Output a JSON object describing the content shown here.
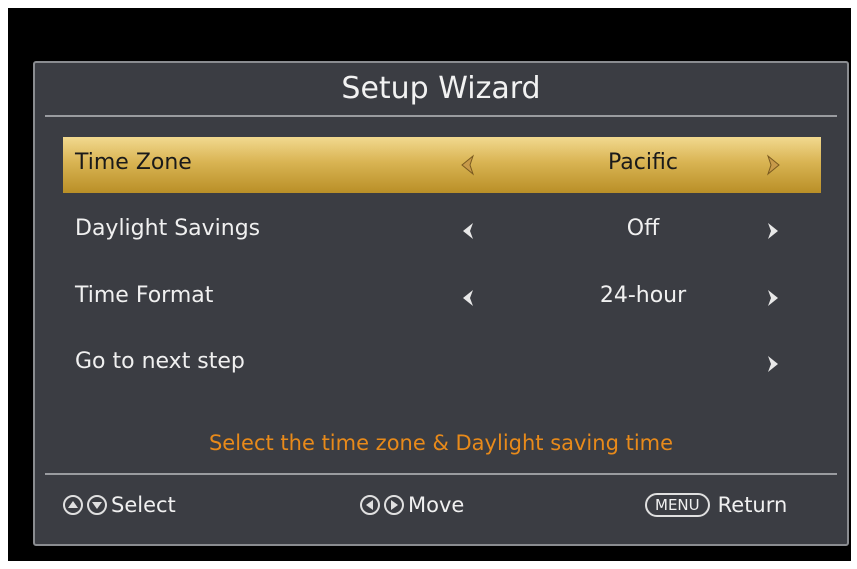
{
  "dialog": {
    "title": "Setup Wizard"
  },
  "rows": [
    {
      "label": "Time Zone",
      "value": "Pacific",
      "selected": true
    },
    {
      "label": "Daylight Savings",
      "value": "Off",
      "selected": false
    },
    {
      "label": "Time Format",
      "value": "24-hour",
      "selected": false
    },
    {
      "label": "Go to next step",
      "value": "",
      "selected": false
    }
  ],
  "hint": "Select the time zone & Daylight saving time",
  "footer": {
    "select_label": "Select",
    "move_label": "Move",
    "menu_key": "MENU",
    "return_label": "Return"
  },
  "colors": {
    "highlight": "#d9b453",
    "hint": "#e88a1a",
    "panel": "#3b3d43"
  },
  "icons": [
    "arrow-left-icon",
    "arrow-right-icon",
    "up-button-icon",
    "down-button-icon",
    "left-button-icon",
    "right-button-icon"
  ]
}
